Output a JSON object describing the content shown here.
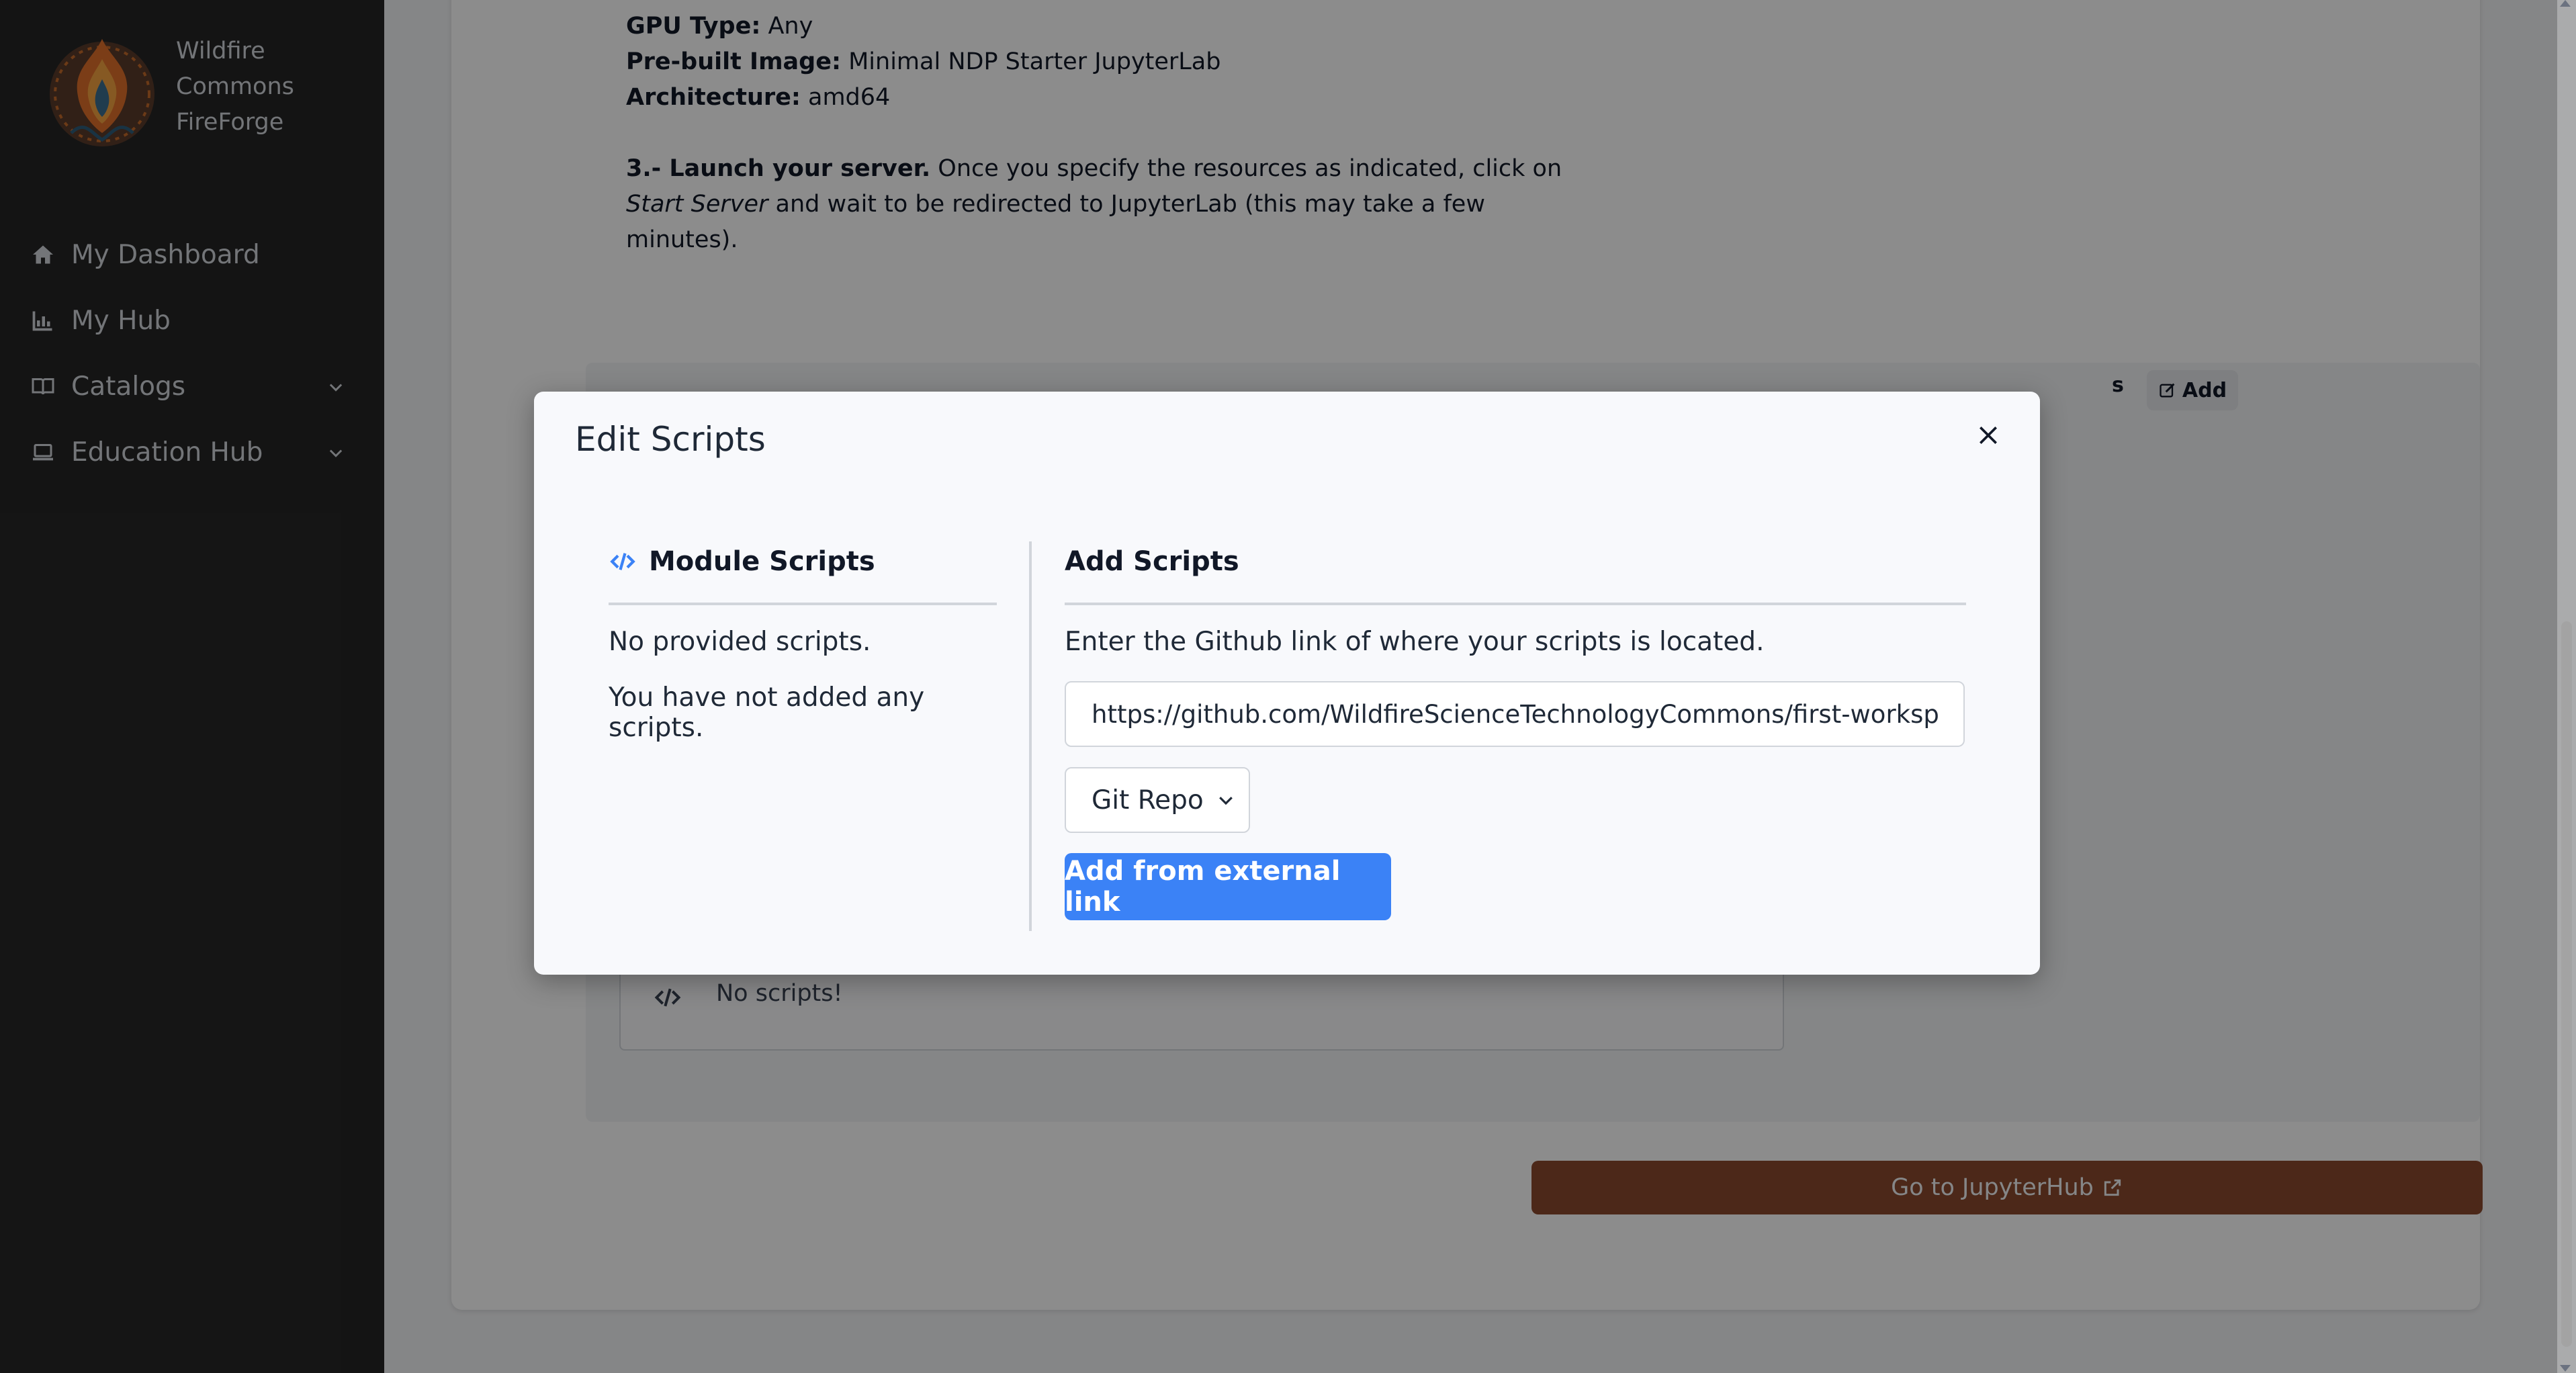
{
  "sidebar": {
    "brand": {
      "line1": "Wildfire",
      "line2": "Commons",
      "line3": "FireForge"
    },
    "items": [
      {
        "label": "My Dashboard",
        "icon": "home-icon"
      },
      {
        "label": "My Hub",
        "icon": "chart-icon"
      },
      {
        "label": "Catalogs",
        "icon": "book-icon"
      },
      {
        "label": "Education Hub",
        "icon": "laptop-icon"
      }
    ]
  },
  "instructions": {
    "gpu_label": "GPU Type:",
    "gpu_value": " Any",
    "image_label": "Pre-built Image:",
    "image_value": " Minimal NDP Starter JupyterLab",
    "arch_label": "Architecture:",
    "arch_value": " amd64",
    "step3_label": "3.- Launch your server.",
    "step3_text_a": " Once you specify the resources as indicated, click on ",
    "step3_italic": "Start Server",
    "step3_text_b": " and wait to be redirected to JupyterLab (this may take a few minutes)."
  },
  "background": {
    "scripts_heading_fragment": "s",
    "add_label": "Add",
    "no_scripts": "No scripts!",
    "jupyterhub_button": "Go to JupyterHub"
  },
  "modal": {
    "title": "Edit Scripts",
    "left": {
      "heading": "Module Scripts",
      "no_provided": "No provided scripts.",
      "not_added": "You have not added any scripts."
    },
    "right": {
      "heading": "Add Scripts",
      "description": "Enter the Github link of where your scripts is located.",
      "url_value": "https://github.com/WildfireScienceTechnologyCommons/first-workspace",
      "type_selected": "Git Repo",
      "submit_label": "Add from external link"
    }
  },
  "colors": {
    "sidebar_bg": "#262626",
    "primary": "#3b82f6",
    "jupyterhub_button": "#8b4a2e"
  }
}
